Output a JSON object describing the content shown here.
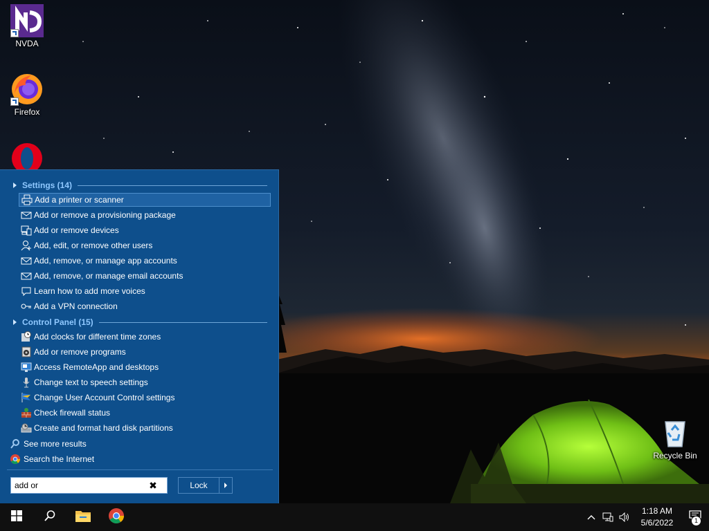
{
  "desktop": {
    "icons": [
      {
        "label": "NVDA",
        "icon": "nvda-icon"
      },
      {
        "label": "Firefox",
        "icon": "firefox-icon"
      },
      {
        "label": "",
        "icon": "opera-icon"
      },
      {
        "label": "Recycle Bin",
        "icon": "recycle-bin-icon"
      }
    ]
  },
  "start_menu": {
    "groups": [
      {
        "header": "Settings (14)",
        "items": [
          {
            "label": "Add a printer or scanner",
            "icon": "printer-icon",
            "selected": true
          },
          {
            "label": "Add or remove a provisioning package",
            "icon": "package-icon"
          },
          {
            "label": "Add or remove devices",
            "icon": "devices-icon"
          },
          {
            "label": "Add, edit, or remove other users",
            "icon": "user-icon"
          },
          {
            "label": "Add, remove, or manage app accounts",
            "icon": "mail-icon"
          },
          {
            "label": "Add, remove, or manage email accounts",
            "icon": "mail-icon"
          },
          {
            "label": "Learn how to add more voices",
            "icon": "speech-icon"
          },
          {
            "label": "Add a VPN connection",
            "icon": "vpn-icon"
          }
        ]
      },
      {
        "header": "Control Panel (15)",
        "items": [
          {
            "label": "Add clocks for different time zones",
            "icon": "clock-icon"
          },
          {
            "label": "Add or remove programs",
            "icon": "programs-icon"
          },
          {
            "label": "Access RemoteApp and desktops",
            "icon": "remoteapp-icon"
          },
          {
            "label": "Change text to speech settings",
            "icon": "microphone-icon"
          },
          {
            "label": "Change User Account Control settings",
            "icon": "uac-flag-icon"
          },
          {
            "label": "Check firewall status",
            "icon": "firewall-icon"
          },
          {
            "label": "Create and format hard disk partitions",
            "icon": "disk-management-icon"
          }
        ]
      }
    ],
    "see_more": "See more results",
    "search_internet": "Search the Internet",
    "search": {
      "value": "add or",
      "placeholder": ""
    },
    "lock_label": "Lock"
  },
  "taskbar": {
    "buttons": [
      "start-icon",
      "search-icon",
      "file-explorer-icon",
      "chrome-icon"
    ],
    "time": "1:18 AM",
    "date": "5/6/2022",
    "notification_count": "1"
  }
}
